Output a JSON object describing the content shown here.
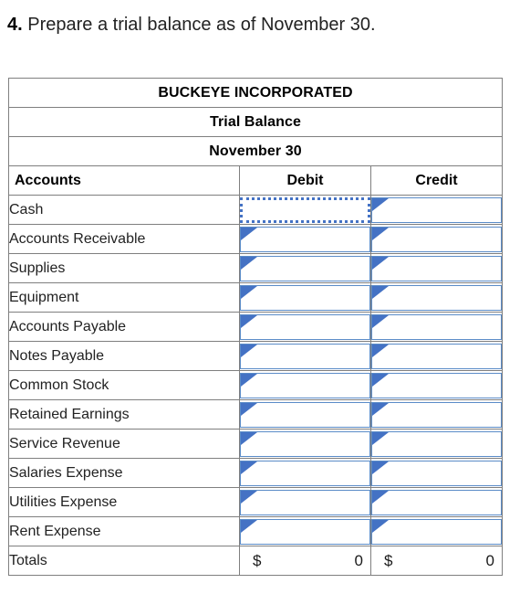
{
  "prompt": {
    "number": "4.",
    "text": "Prepare a trial balance as of November 30."
  },
  "table": {
    "company": "BUCKEYE INCORPORATED",
    "statement": "Trial Balance",
    "period": "November 30",
    "columns": {
      "accounts": "Accounts",
      "debit": "Debit",
      "credit": "Credit"
    },
    "rows": [
      {
        "account": "Cash",
        "debit": "",
        "credit": "",
        "selected": "debit"
      },
      {
        "account": "Accounts Receivable",
        "debit": "",
        "credit": ""
      },
      {
        "account": "Supplies",
        "debit": "",
        "credit": ""
      },
      {
        "account": "Equipment",
        "debit": "",
        "credit": ""
      },
      {
        "account": "Accounts Payable",
        "debit": "",
        "credit": ""
      },
      {
        "account": "Notes Payable",
        "debit": "",
        "credit": ""
      },
      {
        "account": "Common Stock",
        "debit": "",
        "credit": ""
      },
      {
        "account": "Retained Earnings",
        "debit": "",
        "credit": ""
      },
      {
        "account": "Service Revenue",
        "debit": "",
        "credit": ""
      },
      {
        "account": "Salaries Expense",
        "debit": "",
        "credit": ""
      },
      {
        "account": "Utilities Expense",
        "debit": "",
        "credit": ""
      },
      {
        "account": "Rent Expense",
        "debit": "",
        "credit": ""
      }
    ],
    "totals": {
      "label": "Totals",
      "debit_currency": "$",
      "debit_amount": "0",
      "credit_currency": "$",
      "credit_amount": "0"
    }
  },
  "colors": {
    "header_blue": "#85aee0",
    "input_border_blue": "#5b8cc8",
    "marker_blue": "#4472c4",
    "grid_gray": "#7f7f7f",
    "rule_black": "#000000"
  }
}
